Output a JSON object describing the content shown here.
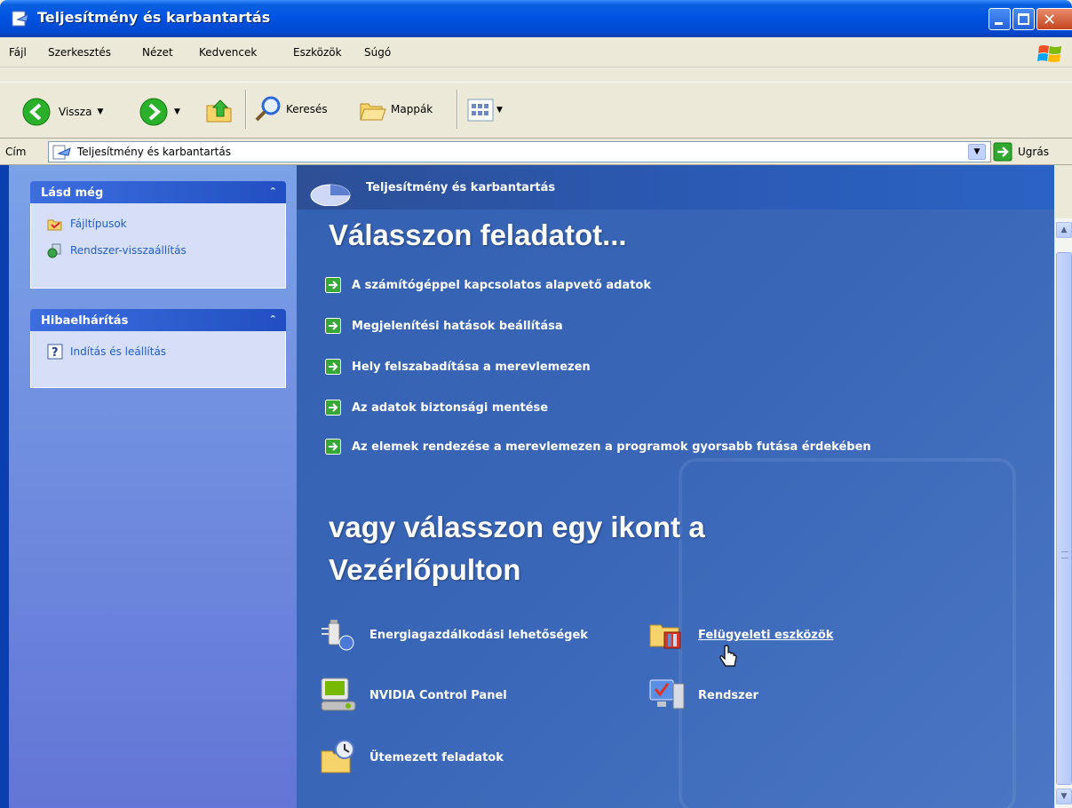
{
  "window": {
    "title": "Teljesítmény és karbantartás",
    "close_glyph": "✕"
  },
  "menu": [
    "Fájl",
    "Szerkesztés",
    "Nézet",
    "Kedvencek",
    "Eszközök",
    "Súgó"
  ],
  "toolbar": {
    "back": "Vissza",
    "search": "Keresés",
    "folders": "Mappák"
  },
  "address": {
    "label": "Cím",
    "value": "Teljesítmény és karbantartás",
    "go": "Ugrás"
  },
  "sidebar": {
    "panels": [
      {
        "title": "Lásd még",
        "links": [
          "Fájltípusok",
          "Rendszer-visszaállítás"
        ]
      },
      {
        "title": "Hibaelhárítás",
        "links": [
          "Indítás és leállítás"
        ]
      }
    ]
  },
  "main": {
    "header": "Teljesítmény és karbantartás",
    "heading": "Válasszon feladatot...",
    "tasks": [
      "A számítógéppel kapcsolatos alapvető adatok",
      "Megjelenítési hatások beállítása",
      "Hely felszabadítása a merevlemezen",
      "Az adatok biztonsági mentése",
      "Az elemek rendezése a merevlemezen a programok gyorsabb futása érdekében"
    ],
    "heading2": "vagy válasszon egy ikont a Vezérlőpulton",
    "icons": [
      {
        "label": "Energiagazdálkodási lehetőségek",
        "icon": "power-options-icon"
      },
      {
        "label": "Felügyeleti eszközök",
        "icon": "admin-tools-icon"
      },
      {
        "label": "NVIDIA Control Panel",
        "icon": "nvidia-icon"
      },
      {
        "label": "Rendszer",
        "icon": "system-icon"
      },
      {
        "label": "Ütemezett feladatok",
        "icon": "scheduled-tasks-icon"
      }
    ]
  },
  "colors": {
    "titlebar": "#0054e3",
    "sidebar": "#7ba2e7",
    "main_bg": "#3561b3",
    "link": "#215dc6"
  }
}
